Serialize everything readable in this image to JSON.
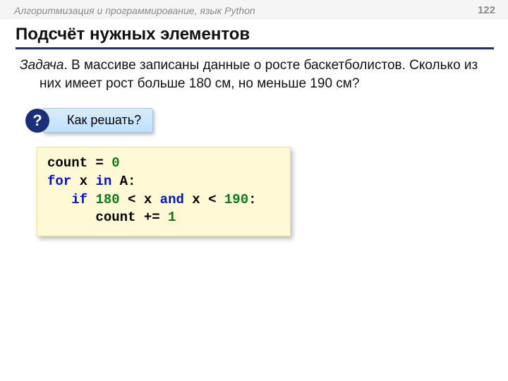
{
  "header": {
    "title": "Алгоритмизация и программирование, язык Python",
    "page": "122"
  },
  "heading": "Подсчёт нужных элементов",
  "task": {
    "label": "Задача",
    "text": ". В массиве записаны данные о росте баскетболистов. Сколько из них имеет рост больше 180 см, но меньше 190 см?"
  },
  "callout": {
    "badge": "?",
    "text": "Как решать?"
  },
  "code": {
    "l1a": "count",
    "l1b": " = ",
    "l1c": "0",
    "l2a": "for",
    "l2b": " x ",
    "l2c": "in",
    "l2d": " A:",
    "l3a": "   ",
    "l3b": "if",
    "l3c": " ",
    "l3d": "180",
    "l3e": " < x ",
    "l3f": "and",
    "l3g": " x < ",
    "l3h": "190",
    "l3i": ":",
    "l4a": "      count += ",
    "l4b": "1"
  }
}
